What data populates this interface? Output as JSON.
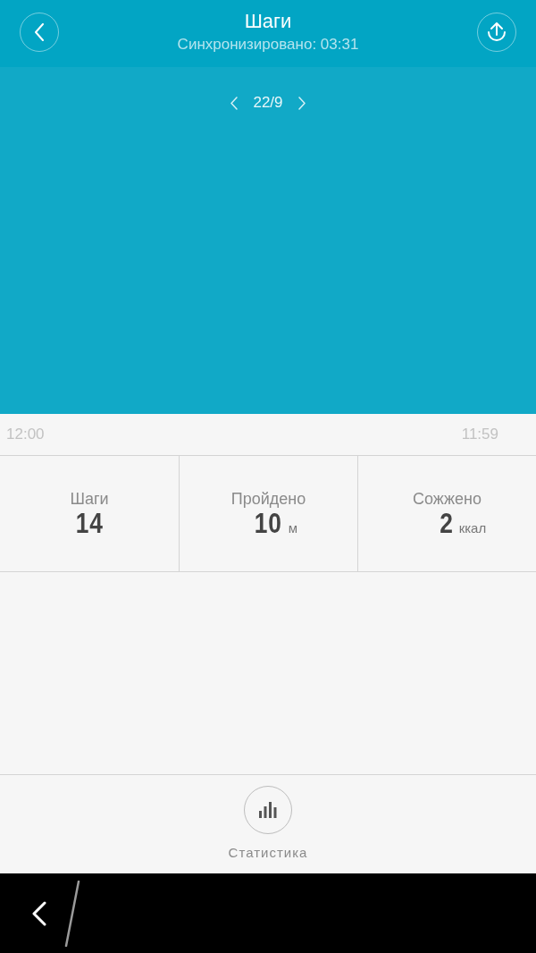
{
  "header": {
    "title": "Шаги",
    "subtitle": "Синхронизировано: 03:31"
  },
  "date_nav": {
    "label": "22/9"
  },
  "time_axis": {
    "start": "12:00",
    "end": "11:59"
  },
  "stats": [
    {
      "label": "Шаги",
      "value": "14"
    },
    {
      "label": "Пройдено",
      "value": "10",
      "unit": "м"
    },
    {
      "label": "Сожжено",
      "value": "2",
      "unit": "ккал"
    }
  ],
  "bottom_action": {
    "label": "Статистика"
  }
}
